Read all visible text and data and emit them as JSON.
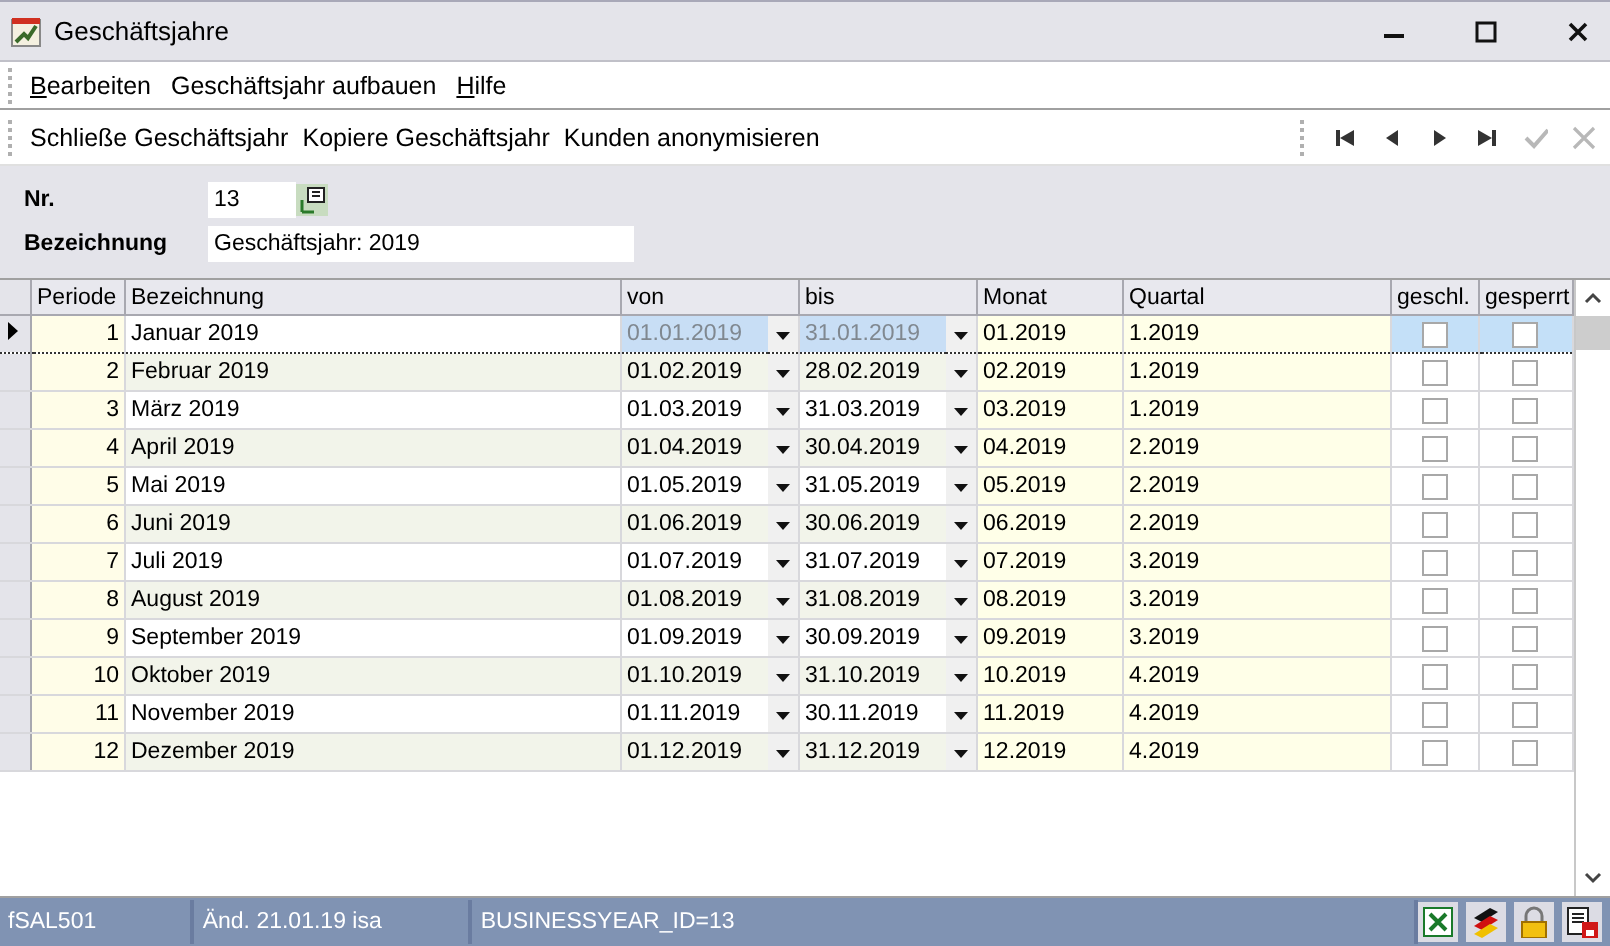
{
  "window": {
    "title": "Geschäftsjahre"
  },
  "menu": [
    {
      "label": "Bearbeiten",
      "mnemonic": true
    },
    {
      "label": "Geschäftsjahr aufbauen",
      "mnemonic": false
    },
    {
      "label": "Hilfe",
      "mnemonic": true
    }
  ],
  "toolbar": {
    "actions": [
      "Schließe Geschäftsjahr",
      "Kopiere Geschäftsjahr",
      "Kunden anonymisieren"
    ],
    "nav": [
      {
        "kind": "first",
        "disabled": false
      },
      {
        "kind": "prev",
        "disabled": false
      },
      {
        "kind": "next",
        "disabled": false
      },
      {
        "kind": "last",
        "disabled": false
      },
      {
        "kind": "confirm",
        "disabled": true
      },
      {
        "kind": "cancel",
        "disabled": true
      }
    ]
  },
  "form": {
    "nr": {
      "label": "Nr.",
      "value": "13"
    },
    "bezeichnung": {
      "label": "Bezeichnung",
      "value": "Geschäftsjahr: 2019"
    }
  },
  "table": {
    "columns": [
      "Periode",
      "Bezeichnung",
      "von",
      "bis",
      "Monat",
      "Quartal",
      "geschl.",
      "gesperrt"
    ],
    "rows": [
      {
        "periode": "1",
        "bezeichnung": "Januar 2019",
        "von": "01.01.2019",
        "bis": "31.01.2019",
        "monat": "01.2019",
        "quartal": "1.2019",
        "geschl": false,
        "gesperrt": false,
        "selected": true
      },
      {
        "periode": "2",
        "bezeichnung": "Februar 2019",
        "von": "01.02.2019",
        "bis": "28.02.2019",
        "monat": "02.2019",
        "quartal": "1.2019",
        "geschl": false,
        "gesperrt": false,
        "selected": false
      },
      {
        "periode": "3",
        "bezeichnung": "März 2019",
        "von": "01.03.2019",
        "bis": "31.03.2019",
        "monat": "03.2019",
        "quartal": "1.2019",
        "geschl": false,
        "gesperrt": false,
        "selected": false
      },
      {
        "periode": "4",
        "bezeichnung": "April 2019",
        "von": "01.04.2019",
        "bis": "30.04.2019",
        "monat": "04.2019",
        "quartal": "2.2019",
        "geschl": false,
        "gesperrt": false,
        "selected": false
      },
      {
        "periode": "5",
        "bezeichnung": "Mai 2019",
        "von": "01.05.2019",
        "bis": "31.05.2019",
        "monat": "05.2019",
        "quartal": "2.2019",
        "geschl": false,
        "gesperrt": false,
        "selected": false
      },
      {
        "periode": "6",
        "bezeichnung": "Juni 2019",
        "von": "01.06.2019",
        "bis": "30.06.2019",
        "monat": "06.2019",
        "quartal": "2.2019",
        "geschl": false,
        "gesperrt": false,
        "selected": false
      },
      {
        "periode": "7",
        "bezeichnung": "Juli 2019",
        "von": "01.07.2019",
        "bis": "31.07.2019",
        "monat": "07.2019",
        "quartal": "3.2019",
        "geschl": false,
        "gesperrt": false,
        "selected": false
      },
      {
        "periode": "8",
        "bezeichnung": "August 2019",
        "von": "01.08.2019",
        "bis": "31.08.2019",
        "monat": "08.2019",
        "quartal": "3.2019",
        "geschl": false,
        "gesperrt": false,
        "selected": false
      },
      {
        "periode": "9",
        "bezeichnung": "September 2019",
        "von": "01.09.2019",
        "bis": "30.09.2019",
        "monat": "09.2019",
        "quartal": "3.2019",
        "geschl": false,
        "gesperrt": false,
        "selected": false
      },
      {
        "periode": "10",
        "bezeichnung": "Oktober 2019",
        "von": "01.10.2019",
        "bis": "31.10.2019",
        "monat": "10.2019",
        "quartal": "4.2019",
        "geschl": false,
        "gesperrt": false,
        "selected": false
      },
      {
        "periode": "11",
        "bezeichnung": "November 2019",
        "von": "01.11.2019",
        "bis": "30.11.2019",
        "monat": "11.2019",
        "quartal": "4.2019",
        "geschl": false,
        "gesperrt": false,
        "selected": false
      },
      {
        "periode": "12",
        "bezeichnung": "Dezember 2019",
        "von": "01.12.2019",
        "bis": "31.12.2019",
        "monat": "12.2019",
        "quartal": "4.2019",
        "geschl": false,
        "gesperrt": false,
        "selected": false
      }
    ]
  },
  "status_bar": [
    "fSAL501",
    "Änd. 21.01.19 isa",
    "BUSINESSYEAR_ID=13"
  ]
}
